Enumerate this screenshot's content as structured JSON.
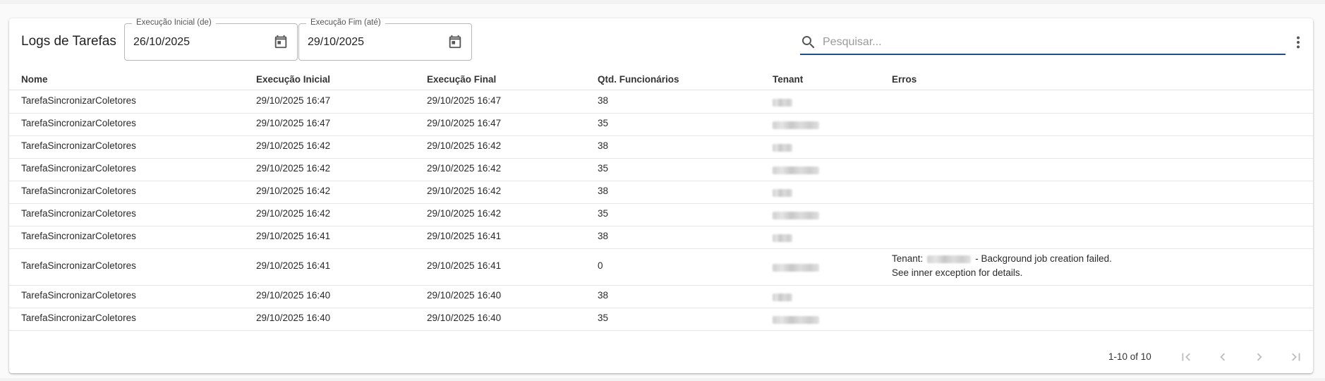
{
  "header": {
    "title": "Logs de Tarefas",
    "date_from": {
      "label": "Execução Inicial (de)",
      "value": "26/10/2025",
      "icon": "calendar-icon"
    },
    "date_to": {
      "label": "Execução Fim (até)",
      "value": "29/10/2025",
      "icon": "calendar-icon"
    },
    "search": {
      "placeholder": "Pesquisar...",
      "value": "",
      "icon": "search-icon"
    },
    "menu_icon": "more-vert-icon"
  },
  "table": {
    "columns": [
      "Nome",
      "Execução Inicial",
      "Execução Final",
      "Qtd. Funcionários",
      "Tenant",
      "Erros"
    ],
    "rows": [
      {
        "nome": "TarefaSincronizarColetores",
        "inicio": "29/10/2025 16:47",
        "fim": "29/10/2025 16:47",
        "qtd": "38",
        "tenant": "[redacted]",
        "erros": ""
      },
      {
        "nome": "TarefaSincronizarColetores",
        "inicio": "29/10/2025 16:47",
        "fim": "29/10/2025 16:47",
        "qtd": "35",
        "tenant": "[redacted]",
        "erros": ""
      },
      {
        "nome": "TarefaSincronizarColetores",
        "inicio": "29/10/2025 16:42",
        "fim": "29/10/2025 16:42",
        "qtd": "38",
        "tenant": "[redacted]",
        "erros": ""
      },
      {
        "nome": "TarefaSincronizarColetores",
        "inicio": "29/10/2025 16:42",
        "fim": "29/10/2025 16:42",
        "qtd": "35",
        "tenant": "[redacted]",
        "erros": ""
      },
      {
        "nome": "TarefaSincronizarColetores",
        "inicio": "29/10/2025 16:42",
        "fim": "29/10/2025 16:42",
        "qtd": "38",
        "tenant": "[redacted]",
        "erros": ""
      },
      {
        "nome": "TarefaSincronizarColetores",
        "inicio": "29/10/2025 16:42",
        "fim": "29/10/2025 16:42",
        "qtd": "35",
        "tenant": "[redacted]",
        "erros": ""
      },
      {
        "nome": "TarefaSincronizarColetores",
        "inicio": "29/10/2025 16:41",
        "fim": "29/10/2025 16:41",
        "qtd": "38",
        "tenant": "[redacted]",
        "erros": ""
      },
      {
        "nome": "TarefaSincronizarColetores",
        "inicio": "29/10/2025 16:41",
        "fim": "29/10/2025 16:41",
        "qtd": "0",
        "tenant": "[redacted]",
        "erros": {
          "prefix": "Tenant:",
          "suffix": "- Background job creation failed.",
          "line2": "See inner exception for details."
        }
      },
      {
        "nome": "TarefaSincronizarColetores",
        "inicio": "29/10/2025 16:40",
        "fim": "29/10/2025 16:40",
        "qtd": "38",
        "tenant": "[redacted]",
        "erros": ""
      },
      {
        "nome": "TarefaSincronizarColetores",
        "inicio": "29/10/2025 16:40",
        "fim": "29/10/2025 16:40",
        "qtd": "35",
        "tenant": "[redacted]",
        "erros": ""
      }
    ]
  },
  "footer": {
    "page_info": "1-10 of 10",
    "buttons": [
      "first-page-icon",
      "prev-page-icon",
      "next-page-icon",
      "last-page-icon"
    ]
  },
  "colors": {
    "accent": "#1f4e8c",
    "icon": "#555555",
    "disabled_icon": "#bdbdbd"
  }
}
